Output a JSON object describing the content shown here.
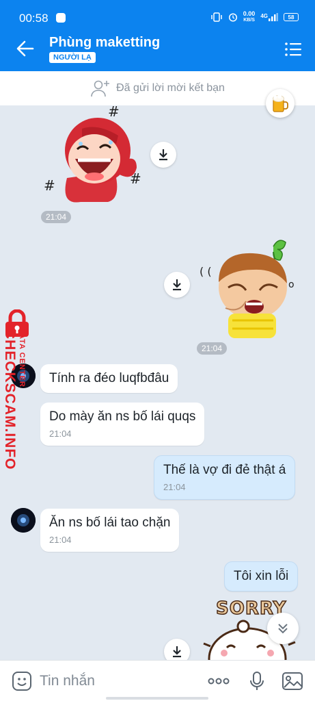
{
  "status_bar": {
    "time": "00:58",
    "net_speed_value": "0.00",
    "net_speed_unit": "KB/S",
    "signal_label": "4G",
    "battery": "58"
  },
  "header": {
    "contact_name": "Phùng maketting",
    "badge": "NGƯỜI LẠ"
  },
  "friend_request": {
    "text": "Đã gửi lời mời kết bạn"
  },
  "messages": {
    "sticker1_time": "21:04",
    "sticker2_time": "21:04",
    "m1_text": "Tính ra đéo luqfbđâu",
    "m2_text": "Do mày ăn ns bố lái quqs",
    "m2_time": "21:04",
    "m3_text": "Thế là vợ đi đẻ thật á",
    "m3_time": "21:04",
    "m4_text": "Ăn ns bố lái tao chặn",
    "m4_time": "21:04",
    "m5_text": "Tôi xin lỗi",
    "sticker3_text": "SORRY"
  },
  "watermark": {
    "brand": "CHECKSCAM.INFO",
    "sub": "DATA CENTER"
  },
  "composer": {
    "placeholder": "Tin nhắn"
  },
  "colors": {
    "accent": "#0c83ef",
    "chat_bg": "#e2e9f1",
    "my_bubble": "#d6ebfd",
    "watermark_red": "#e3232a"
  }
}
